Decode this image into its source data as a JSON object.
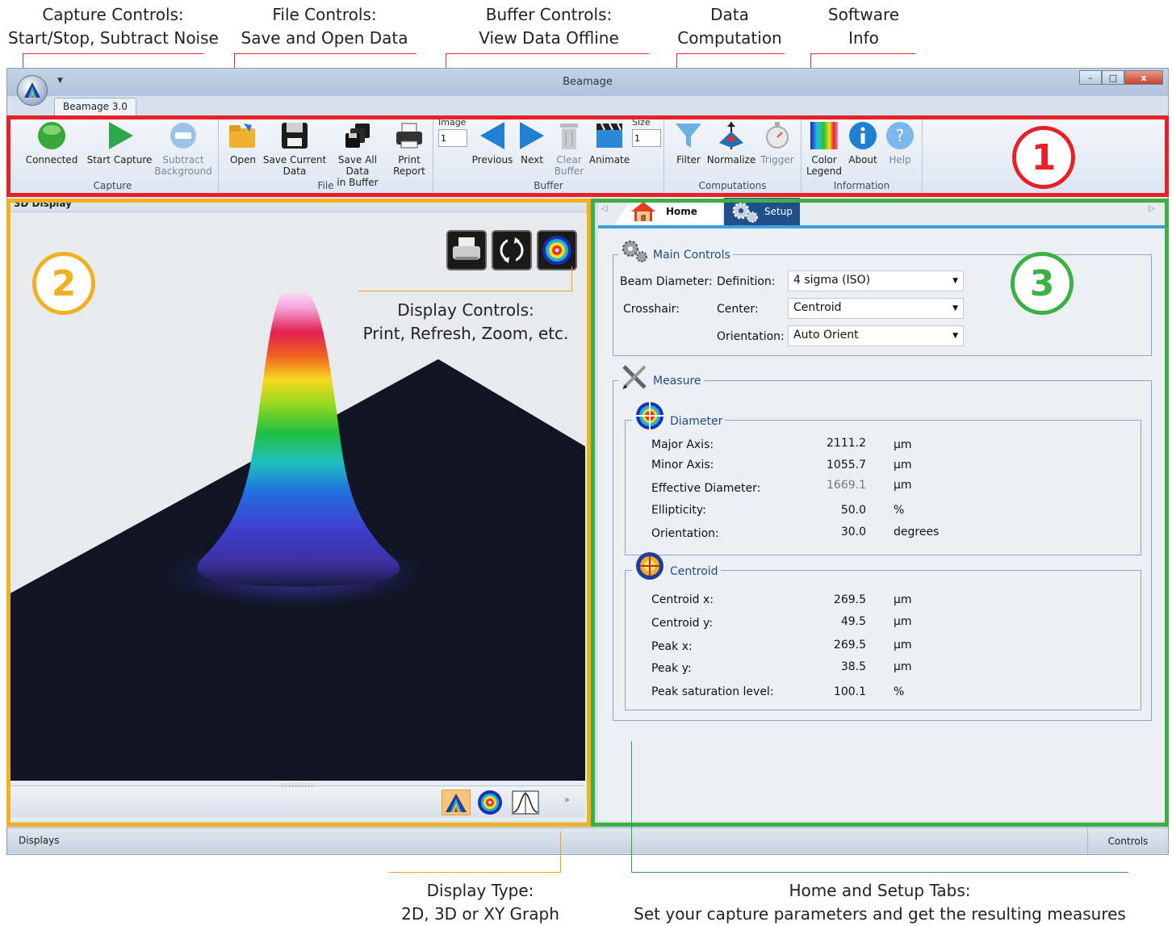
{
  "annotations": {
    "capture": [
      "Capture Controls:",
      "Start/Stop, Subtract Noise"
    ],
    "file": [
      "File Controls:",
      "Save and Open Data"
    ],
    "buffer": [
      "Buffer Controls:",
      "View Data Offline"
    ],
    "data": [
      "Data",
      "Computation"
    ],
    "software": [
      "Software",
      "Info"
    ],
    "display_controls": [
      "Display Controls:",
      "Print, Refresh, Zoom, etc."
    ],
    "display_type": [
      "Display Type:",
      "2D, 3D or XY Graph"
    ],
    "tabs": [
      "Home and Setup Tabs:",
      "Set your capture parameters and get the resulting measures"
    ],
    "badges": [
      "1",
      "2",
      "3"
    ]
  },
  "colors": {
    "red": "#e8202a",
    "orange": "#f0b020",
    "green": "#3cb043",
    "accent": "#1f4c84"
  },
  "window": {
    "title": "Beamage",
    "app_tab": "Beamage 3.0",
    "minimize": "–",
    "maximize": "□",
    "close": "x"
  },
  "ribbon": {
    "capture": {
      "label": "Capture",
      "connected": "Connected",
      "start": "Start Capture",
      "subtract": [
        "Subtract",
        "Background"
      ]
    },
    "file": {
      "label": "File",
      "open": "Open",
      "save_current": [
        "Save Current",
        "Data"
      ],
      "save_all": [
        "Save All Data",
        "in Buffer"
      ],
      "print": [
        "Print",
        "Report"
      ]
    },
    "buffer": {
      "label": "Buffer",
      "image_label": "Image",
      "image_value": "1",
      "previous": "Previous",
      "next": "Next",
      "clear": [
        "Clear",
        "Buffer"
      ],
      "animate": "Animate",
      "size_label": "Size",
      "size_value": "1"
    },
    "computations": {
      "label": "Computations",
      "filter": "Filter",
      "normalize": "Normalize",
      "trigger": "Trigger"
    },
    "information": {
      "label": "Information",
      "color_legend": [
        "Color",
        "Legend"
      ],
      "about": "About",
      "help": "Help"
    }
  },
  "left_panel": {
    "title": "3D Display"
  },
  "right_panel": {
    "tabs": {
      "home": "Home",
      "setup": "Setup"
    },
    "main_controls": {
      "title": "Main Controls",
      "beam_diameter": "Beam Diameter:",
      "definition_label": "Definition:",
      "definition_value": "4 sigma (ISO)",
      "crosshair": "Crosshair:",
      "center_label": "Center:",
      "center_value": "Centroid",
      "orientation_label": "Orientation:",
      "orientation_value": "Auto Orient"
    },
    "measure": {
      "title": "Measure",
      "diameter": {
        "title": "Diameter",
        "rows": [
          {
            "label": "Major Axis:",
            "value": "2111.2",
            "unit": "µm"
          },
          {
            "label": "Minor Axis:",
            "value": "1055.7",
            "unit": "µm"
          },
          {
            "label": "Effective Diameter:",
            "value": "1669.1",
            "unit": "µm"
          },
          {
            "label": "Ellipticity:",
            "value": "50.0",
            "unit": "%"
          },
          {
            "label": "Orientation:",
            "value": "30.0",
            "unit": "degrees"
          }
        ]
      },
      "centroid": {
        "title": "Centroid",
        "rows": [
          {
            "label": "Centroid x:",
            "value": "269.5",
            "unit": "µm"
          },
          {
            "label": "Centroid y:",
            "value": "49.5",
            "unit": "µm"
          },
          {
            "label": "Peak x:",
            "value": "269.5",
            "unit": "µm"
          },
          {
            "label": "Peak y:",
            "value": "38.5",
            "unit": "µm"
          },
          {
            "label": "Peak saturation level:",
            "value": "100.1",
            "unit": "%"
          }
        ]
      }
    }
  },
  "statusbar": {
    "left": "Displays",
    "right": "Controls"
  }
}
